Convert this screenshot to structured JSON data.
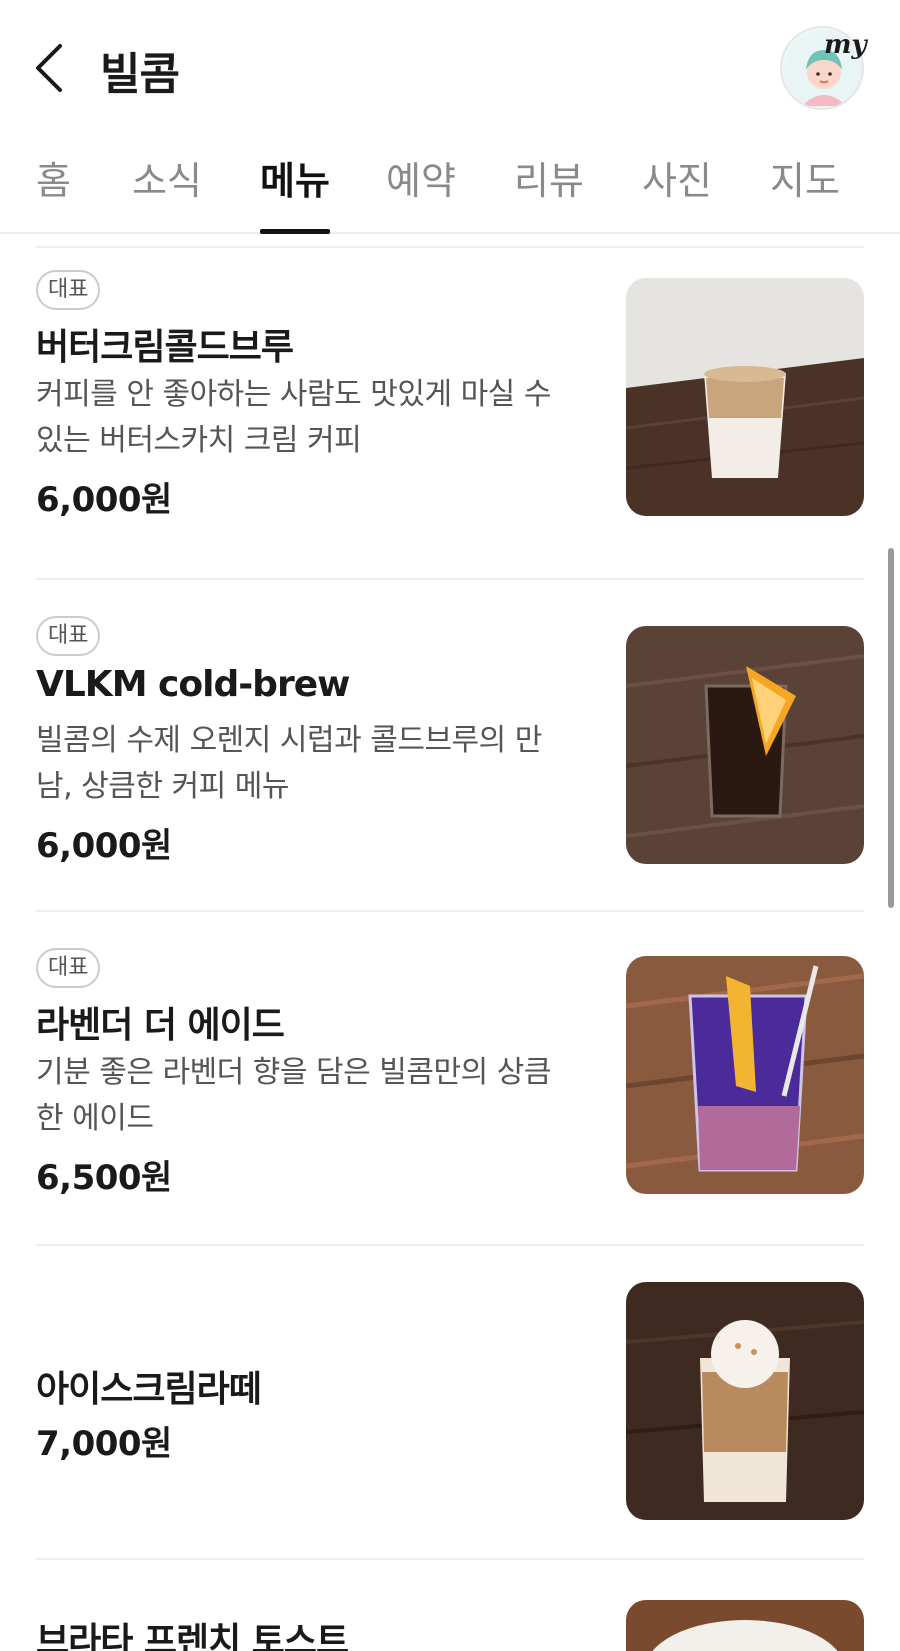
{
  "header": {
    "title": "빌콤",
    "avatar_badge": "my"
  },
  "tabs": [
    {
      "label": "홈"
    },
    {
      "label": "소식"
    },
    {
      "label": "메뉴",
      "active": true
    },
    {
      "label": "예약"
    },
    {
      "label": "리뷰"
    },
    {
      "label": "사진"
    },
    {
      "label": "지도"
    }
  ],
  "menu": {
    "items": [
      {
        "badge": "대표",
        "name": "버터크림콜드브루",
        "desc_line1": "커피를 안 좋아하는 사람도 맛있게 마실 수",
        "desc_line2": "있는 버터스카치 크림 커피",
        "price": "6,000원"
      },
      {
        "badge": "대표",
        "name": "VLKM cold-brew",
        "desc_line1": "빌콤의 수제 오렌지 시럽과 콜드브루의 만",
        "desc_line2": "남, 상큼한 커피 메뉴",
        "price": "6,000원"
      },
      {
        "badge": "대표",
        "name": "라벤더 더 에이드",
        "desc_line1": "기분 좋은 라벤더 향을 담은 빌콤만의 상큼",
        "desc_line2": "한 에이드",
        "price": "6,500원"
      },
      {
        "name": "아이스크림라떼",
        "price": "7,000원"
      },
      {
        "name": "브라타 프렌치 토스트"
      }
    ]
  },
  "colors": {
    "active_tab": "#111111",
    "inactive_tab": "#8a8a8a",
    "desc_text": "#555555",
    "divider": "#eeeeee"
  }
}
